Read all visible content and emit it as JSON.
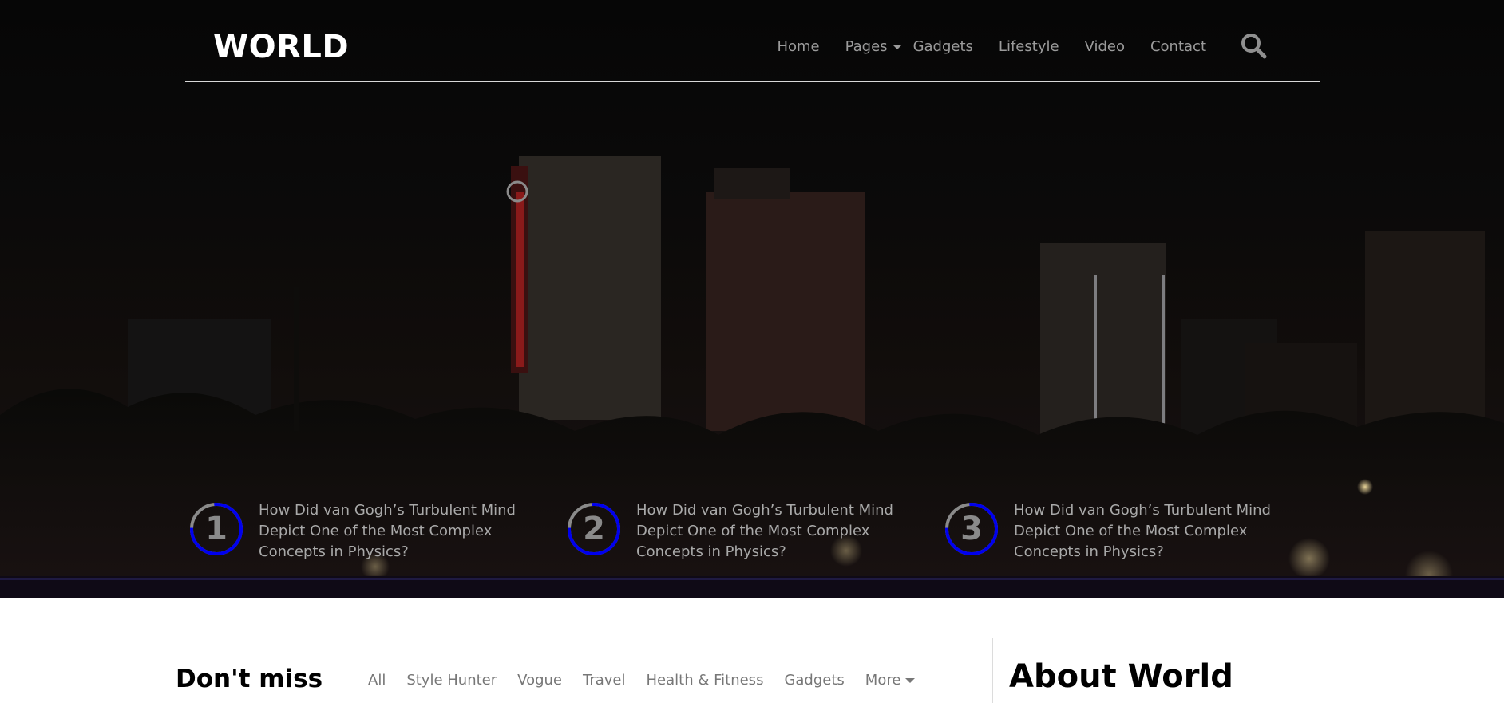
{
  "header": {
    "logo": "WORLD",
    "nav": [
      {
        "label": "Home"
      },
      {
        "label": "Pages",
        "has_dropdown": true
      },
      {
        "label": "Gadgets"
      },
      {
        "label": "Lifestyle"
      },
      {
        "label": "Video"
      },
      {
        "label": "Contact"
      }
    ],
    "search_icon": "search-icon"
  },
  "trending": [
    {
      "number": "1",
      "title": "How Did van Gogh’s Turbulent Mind Depict One of the Most Complex Concepts in Physics?"
    },
    {
      "number": "2",
      "title": "How Did van Gogh’s Turbulent Mind Depict One of the Most Complex Concepts in Physics?"
    },
    {
      "number": "3",
      "title": "How Did van Gogh’s Turbulent Mind Depict One of the Most Complex Concepts in Physics?"
    }
  ],
  "dont_miss": {
    "title": "Don't miss",
    "tabs": [
      "All",
      "Style Hunter",
      "Vogue",
      "Travel",
      "Health & Fitness",
      "Gadgets"
    ],
    "more_label": "More"
  },
  "sidebar": {
    "about_title": "About World"
  },
  "colors": {
    "accent_ring": "#0000ee",
    "ring_base": "#8a8a8a",
    "nav_text": "#9b9b9b"
  }
}
